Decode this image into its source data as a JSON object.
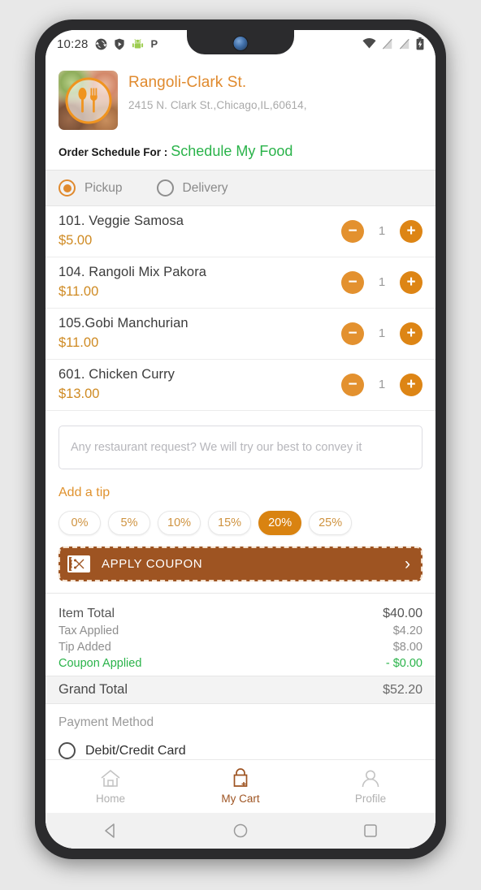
{
  "status_bar": {
    "time": "10:28",
    "left_icons": [
      "sync-icon",
      "shield-icon",
      "android-icon",
      "p-app-icon"
    ],
    "right_icons": [
      "wifi-icon",
      "signal-off-icon",
      "signal-off-icon",
      "battery-charging-icon"
    ]
  },
  "restaurant": {
    "logo_icon": "spoon-fork-icon",
    "name": "Rangoli-Clark St.",
    "address": "2415 N. Clark St.,Chicago,IL,60614,"
  },
  "schedule": {
    "label": "Order Schedule For :",
    "value": "Schedule My Food"
  },
  "order_mode": {
    "selected": "Pickup",
    "options": [
      {
        "label": "Pickup",
        "selected": true
      },
      {
        "label": "Delivery",
        "selected": false
      }
    ]
  },
  "cart": {
    "items": [
      {
        "name": "101. Veggie Samosa",
        "price": "$5.00",
        "qty": "1"
      },
      {
        "name": "104. Rangoli Mix Pakora",
        "price": "$11.00",
        "qty": "1"
      },
      {
        "name": "105.Gobi Manchurian",
        "price": "$11.00",
        "qty": "1"
      },
      {
        "name": "601. Chicken Curry",
        "price": "$13.00",
        "qty": "1"
      }
    ],
    "decrement_label": "−",
    "increment_label": "+"
  },
  "note": {
    "value": "",
    "placeholder": "Any restaurant request? We will try our best to convey it"
  },
  "tip": {
    "title": "Add a tip",
    "options": [
      {
        "label": "0%",
        "selected": false
      },
      {
        "label": "5%",
        "selected": false
      },
      {
        "label": "10%",
        "selected": false
      },
      {
        "label": "15%",
        "selected": false
      },
      {
        "label": "20%",
        "selected": true
      },
      {
        "label": "25%",
        "selected": false
      }
    ]
  },
  "coupon": {
    "icon": "coupon-ticket-icon",
    "label": "APPLY COUPON",
    "chevron": "›"
  },
  "totals": {
    "rows": [
      {
        "label": "Item Total",
        "value": "$40.00"
      },
      {
        "label": "Tax Applied",
        "value": "$4.20"
      },
      {
        "label": "Tip Added",
        "value": "$8.00"
      },
      {
        "label": "Coupon Applied",
        "value": "- $0.00"
      }
    ],
    "grand": {
      "label": "Grand Total",
      "value": "$52.20"
    }
  },
  "payment": {
    "title": "Payment Method",
    "option_label": "Debit/Credit Card",
    "option_selected": false
  },
  "bottom_nav": {
    "items": [
      {
        "label": "Home",
        "icon": "home-icon",
        "active": false
      },
      {
        "label": "My Cart",
        "icon": "cart-icon",
        "active": true
      },
      {
        "label": "Profile",
        "icon": "profile-icon",
        "active": false
      }
    ]
  },
  "android_nav": {
    "back": "back-triangle-icon",
    "home": "home-circle-icon",
    "recents": "recents-square-icon"
  },
  "colors": {
    "accent_orange": "#e08a2e",
    "coupon_brown": "#9e5422",
    "green": "#2ab34a",
    "price_gold": "#cf8a22"
  }
}
